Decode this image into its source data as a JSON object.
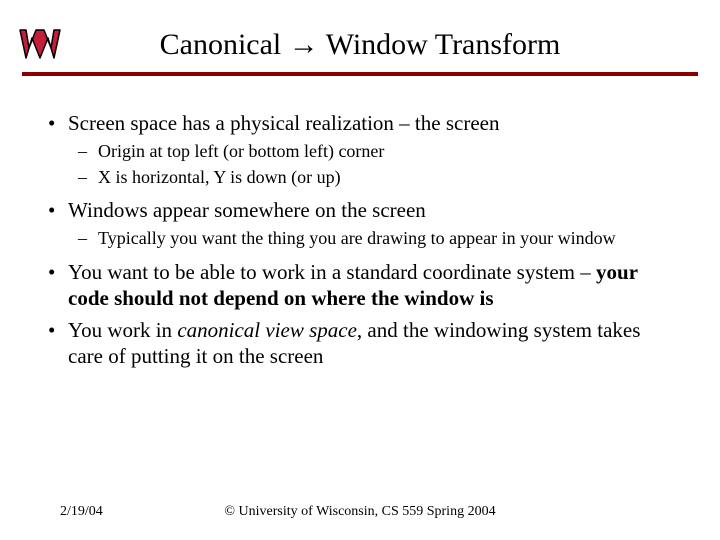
{
  "title_prefix": "Canonical ",
  "title_suffix": " Window Transform",
  "arrow": "→",
  "bullets": [
    {
      "text": "Screen space has a physical realization – the screen",
      "sub": [
        "Origin at top left (or bottom left) corner",
        "X is horizontal, Y is down (or up)"
      ]
    },
    {
      "text": "Windows appear somewhere on the screen",
      "sub": [
        "Typically you want the thing you are drawing to appear in your window"
      ]
    },
    {
      "text_html": "You want to be able to work in a standard coordinate system – <b>your code should not depend on where the window is</b>",
      "sub": []
    },
    {
      "text_html": "You work in <i>canonical view space</i>, and the windowing system takes care of putting it on the screen",
      "sub": []
    }
  ],
  "footer": {
    "date": "2/19/04",
    "copyright": "© University of Wisconsin, CS 559 Spring 2004"
  }
}
